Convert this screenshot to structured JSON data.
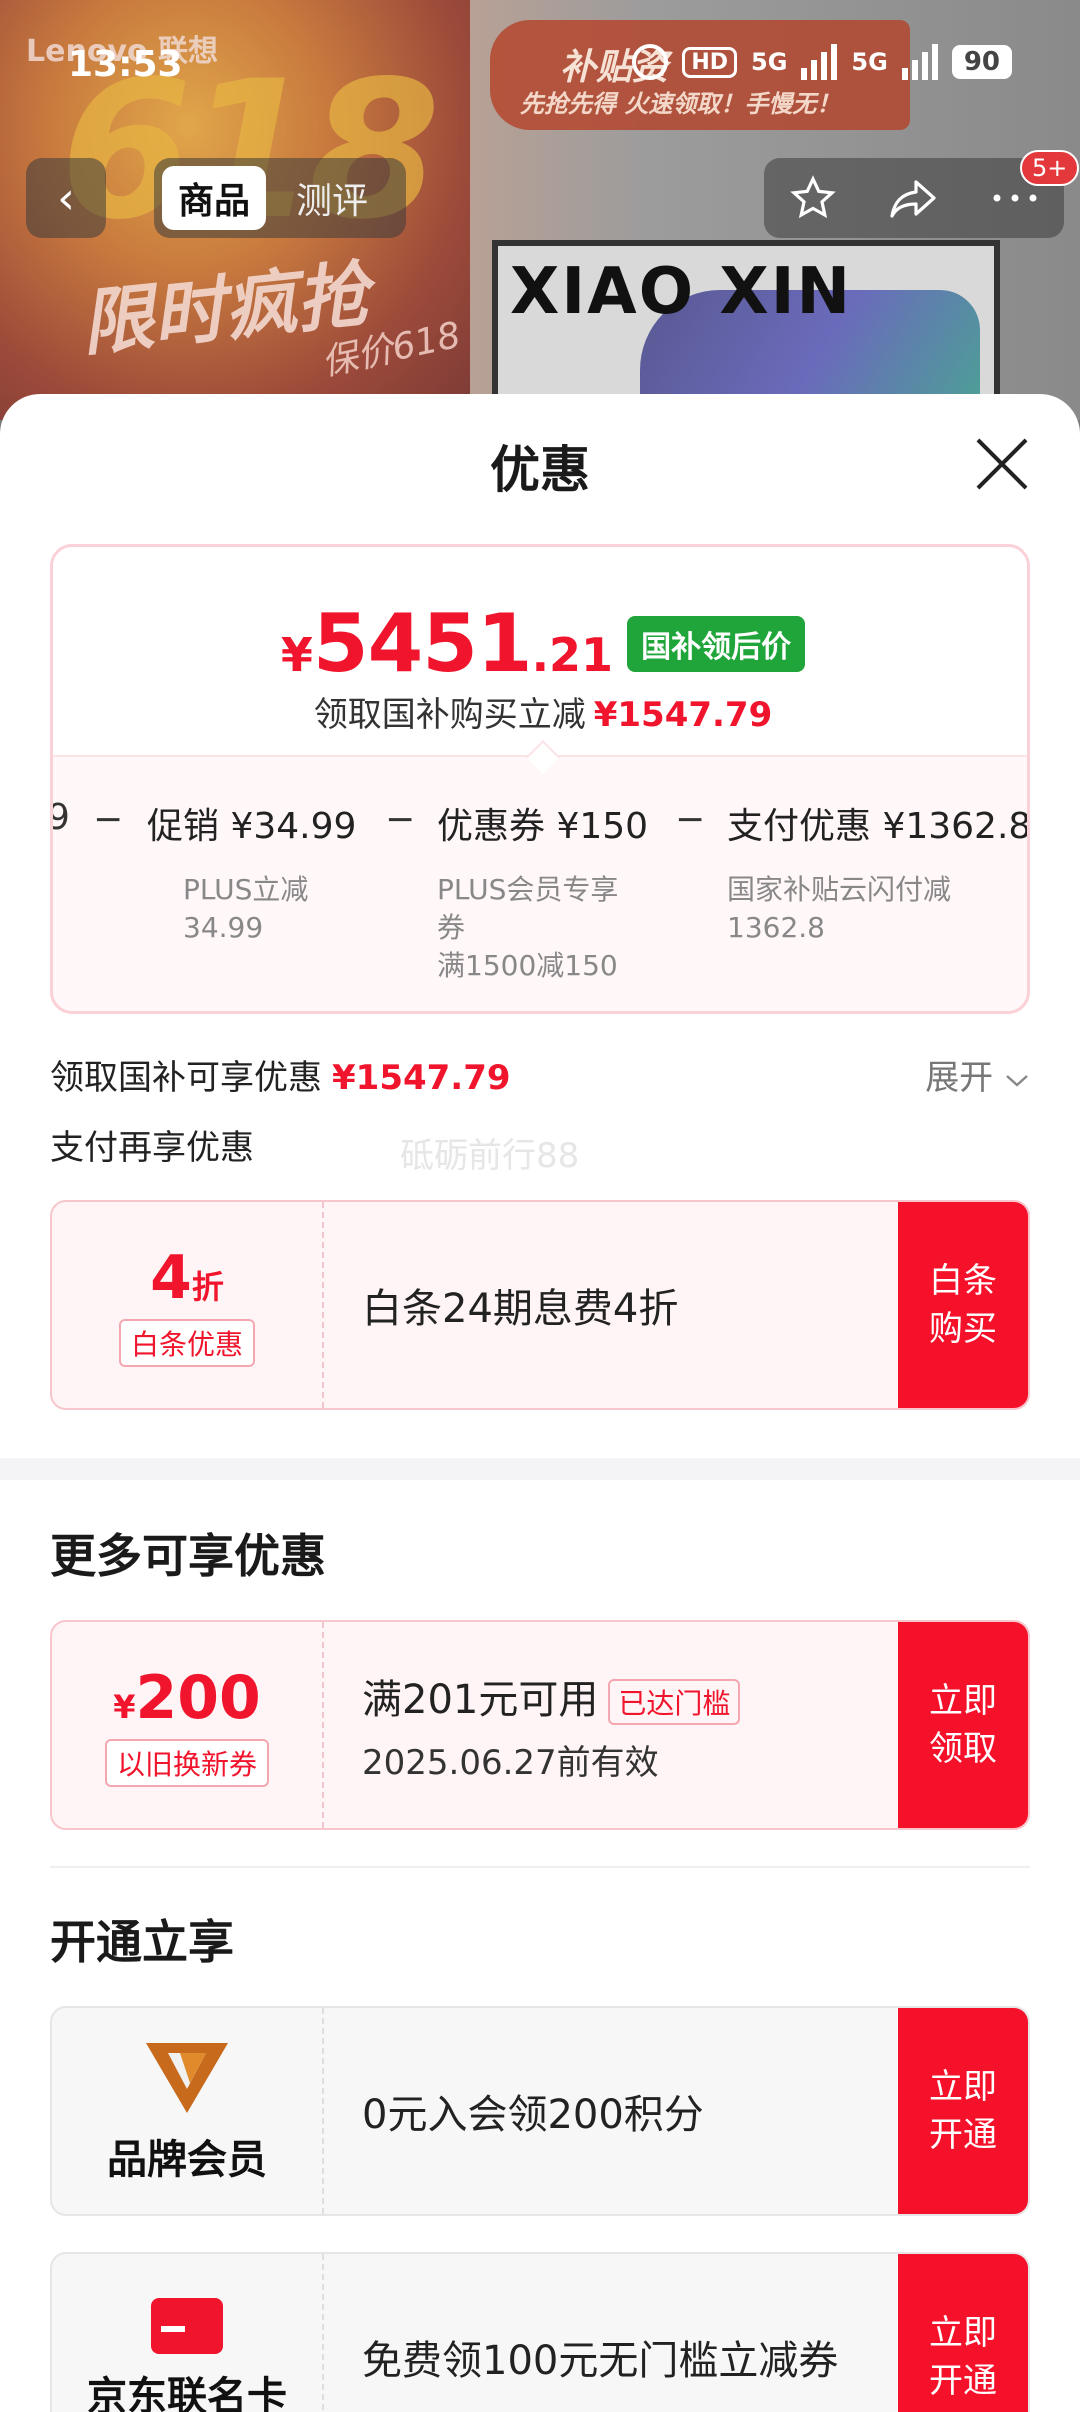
{
  "status_bar": {
    "time": "13:53",
    "hd": "HD",
    "net1": "5G",
    "net2": "5G",
    "battery": "90"
  },
  "background": {
    "brand": "Lenovo 联想",
    "promo_618": "618",
    "promo_title": "限时疯抢",
    "promo_guard": "保价618",
    "subsidy_title": "补贴资",
    "subsidy_sub": "先抢先得 火速领取！手慢无！",
    "product_logo": "XIAO XIN"
  },
  "nav": {
    "back": "‹",
    "tabs": [
      {
        "label": "商品"
      },
      {
        "label": "测评"
      }
    ],
    "badge": "5+"
  },
  "sheet": {
    "title": "优惠",
    "price": {
      "currency": "¥",
      "integer": "5451",
      "decimal": ".21",
      "tag": "国补领后价",
      "subtitle": "领取国补购买立减",
      "subtitle_amount": "¥1547.79"
    },
    "breakdown": {
      "leading_cut": "9",
      "items": [
        {
          "head": "促销 ¥34.99",
          "desc": "PLUS立减\n34.99"
        },
        {
          "head": "优惠券 ¥150",
          "desc": "PLUS会员专享\n券\n满1500减150"
        },
        {
          "head": "支付优惠 ¥1362.8",
          "desc": "国家补贴云闪付减\n1362.8"
        }
      ]
    },
    "subsidy_line": {
      "label": "领取国补可享优惠",
      "amount": "¥1547.79",
      "expand": "展开"
    },
    "pay_more": "支付再享优惠",
    "watermark": "砥砺前行88",
    "baitiao": {
      "discount_num": "4",
      "discount_unit": "折",
      "tag": "白条优惠",
      "title": "白条24期息费4折",
      "cta": "白条\n购买"
    },
    "more_title": "更多可享优惠",
    "trade_in": {
      "currency": "¥",
      "amount": "200",
      "tag": "以旧换新券",
      "title": "满201元可用",
      "threshold": "已达门槛",
      "validity": "2025.06.27前有效",
      "cta": "立即\n领取"
    },
    "open_title": "开通立享",
    "brand_member": {
      "name": "品牌会员",
      "title": "0元入会领200积分",
      "cta": "立即\n开通"
    },
    "jd_card": {
      "name": "京东联名卡",
      "title": "免费领100元无门槛立减券",
      "cta": "立即\n开通"
    }
  },
  "colors": {
    "accent_red": "#f0152c",
    "green_tag": "#20a53a"
  }
}
